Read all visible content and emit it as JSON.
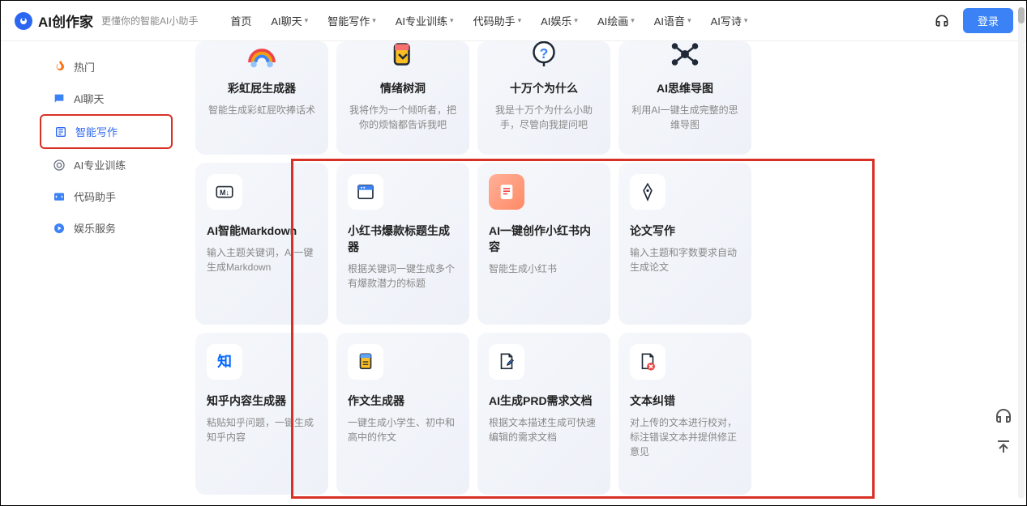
{
  "brand": "AI创作家",
  "tagline": "更懂你的智能AI小助手",
  "nav": [
    {
      "label": "首页",
      "dropdown": false
    },
    {
      "label": "AI聊天",
      "dropdown": true
    },
    {
      "label": "智能写作",
      "dropdown": true
    },
    {
      "label": "AI专业训练",
      "dropdown": true
    },
    {
      "label": "代码助手",
      "dropdown": true
    },
    {
      "label": "AI娱乐",
      "dropdown": true
    },
    {
      "label": "AI绘画",
      "dropdown": true
    },
    {
      "label": "AI语音",
      "dropdown": true
    },
    {
      "label": "AI写诗",
      "dropdown": true
    }
  ],
  "login_label": "登录",
  "sidebar": [
    {
      "label": "热门",
      "icon": "fire-icon",
      "color": "#f97316"
    },
    {
      "label": "Al聊天",
      "icon": "chat-icon",
      "color": "#3b82f6"
    },
    {
      "label": "智能写作",
      "icon": "writing-icon",
      "color": "#2c67f2",
      "active": true
    },
    {
      "label": "AI专业训练",
      "icon": "training-icon",
      "color": "#6b7280"
    },
    {
      "label": "代码助手",
      "icon": "code-icon",
      "color": "#3b82f6"
    },
    {
      "label": "娱乐服务",
      "icon": "entertainment-icon",
      "color": "#3b82f6"
    }
  ],
  "row0": [
    {
      "title": "彩虹屁生成器",
      "desc": "智能生成彩虹屁吹捧话术"
    },
    {
      "title": "情绪树洞",
      "desc": "我将作为一个倾听者，把你的烦恼都告诉我吧"
    },
    {
      "title": "十万个为什么",
      "desc": "我是十万个为什么小助手，尽管向我提问吧"
    },
    {
      "title": "AI思维导图",
      "desc": "利用AI一键生成完整的思维导图"
    }
  ],
  "row1": [
    {
      "title": "AI智能Markdown",
      "desc": "输入主题关键词，AI一键生成Markdown"
    },
    {
      "title": "小红书爆款标题生成器",
      "desc": "根据关键词一键生成多个有爆款潜力的标题"
    },
    {
      "title": "AI一键创作小红书内容",
      "desc": "智能生成小红书"
    },
    {
      "title": "论文写作",
      "desc": "输入主题和字数要求自动生成论文"
    }
  ],
  "row2": [
    {
      "title": "知乎内容生成器",
      "desc": "粘贴知乎问题，一键生成知乎内容"
    },
    {
      "title": "作文生成器",
      "desc": "一键生成小学生、初中和高中的作文"
    },
    {
      "title": "AI生成PRD需求文档",
      "desc": "根据文本描述生成可快速编辑的需求文档"
    },
    {
      "title": "文本纠错",
      "desc": "对上传的文本进行校对，标注错误文本并提供修正意见"
    }
  ]
}
